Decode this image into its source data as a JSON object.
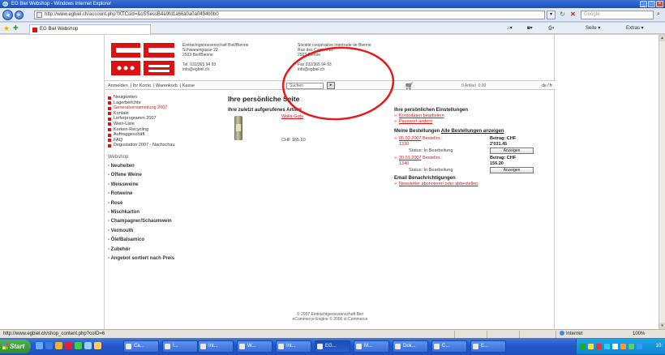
{
  "window": {
    "title": "EG Biel Webshop - Windows Internet Explorer",
    "url": "http://www.egbiel.ch/account.php?XTCsid=&oSSessB4a9fd1a66a0a0a0494b0b0",
    "search_placeholder": "Google",
    "tab_title": "EG Biel Webshop",
    "cmd_home": "▾",
    "cmd_feeds": "▾",
    "cmd_print": "▾",
    "cmd_page": "Seite ▾",
    "cmd_tools": "Extras ▾"
  },
  "header": {
    "address_left": "Eintrachtgenossenschaft Biel/Bienne\nSchwanengasse 22\n2503 Biel/Bienne",
    "address_right": "Société coopérative Intertrade de Bienne\nRue des Cygnes 22\n2503 Bienne",
    "phone": "Tel. 032/365 94 93\ninfo@egbiel.ch",
    "fax": "Fax 032/365 94 93\ninfo@egbiel.ch"
  },
  "topnav": {
    "links": [
      "Anmelden",
      "Ihr Konto",
      "Warenkorb",
      "Kasse"
    ],
    "search_value": "Suchen",
    "search_button": "▸",
    "artikel": "0 Artikel",
    "artikel_sum": "0.00",
    "language": "de / fr"
  },
  "sidebar": {
    "news": [
      {
        "label": "Neuigkeiten",
        "hl": false
      },
      {
        "label": "Lagerberichte",
        "hl": false
      },
      {
        "label": "Generalversammlung 2007",
        "hl": true
      },
      {
        "label": "Kontakt",
        "hl": false
      },
      {
        "label": "Lieferprogramm 2007",
        "hl": false
      },
      {
        "label": "Wein-Liste",
        "hl": false
      },
      {
        "label": "Korken-Recycling",
        "hl": false
      },
      {
        "label": "Auftraggeschäft",
        "hl": false
      },
      {
        "label": "FAQ",
        "hl": false
      },
      {
        "label": "Degustation 2007 - Nachschau",
        "hl": false
      }
    ],
    "shop_heading": "Webshop",
    "categories": [
      "Neuheiten",
      "Offene Weine",
      "Weissweine",
      "Rotweine",
      "Rosé",
      "Mischkarton",
      "Champagner/Schaumwein",
      "Vermouth",
      "Öle/Balsamico",
      "Zubehör",
      "Angebot sortiert nach Preis"
    ]
  },
  "main": {
    "title": "Ihre persönliche Seite",
    "last_product_heading": "Ihre zuletzt aufgerufenes Artikel",
    "product_link": "Walla Gutu",
    "product_price": "CHF 165.60",
    "settings_heading": "Ihre persönlichen Einstellungen",
    "settings_links": [
      "Kontodaten bearbeiten",
      "Passwort ändern"
    ],
    "orders_heading": "Meine Bestellungen",
    "orders_all": "Alle Bestellungen anzeigen",
    "orders": [
      {
        "date": "05.02.2007",
        "nr_label": "Bestellnr.:",
        "nr": "1330",
        "amount": "Betrag: CHF\n2'031.45",
        "status": "Status: In Bearbeitung",
        "button": "Anzeigen"
      },
      {
        "date": "30.01.2007",
        "nr_label": "Bestellnr.:",
        "nr": "1340",
        "amount": "Betrag: CHF\n156.20",
        "status": "Status: In Bearbeitung",
        "button": "Anzeigen"
      }
    ],
    "email_heading": "Email Benachrichtigungen",
    "email_link": "Newsletter abonnieren oder abbestellen"
  },
  "footer": {
    "line1": "© 2007 Eintrachtgenossenschaft Biel",
    "line2": "eCommerce Engine © 2006 xt:Commerce"
  },
  "statusbar": {
    "url": "http://www.egbiel.ch/shop_content.php?coID=6",
    "zone": "Internet",
    "zoom": "100%"
  },
  "taskbar": {
    "start": "Start",
    "tasks": [
      "Ca...",
      "I...",
      "Int...",
      "W...",
      "Int...",
      "EG...",
      "M...",
      "Dok...",
      "C...",
      "E..."
    ],
    "active_index": 5,
    "clock": "10:"
  },
  "colors": {
    "brand_red": "#d11",
    "annotation_red": "#e41b1b"
  }
}
